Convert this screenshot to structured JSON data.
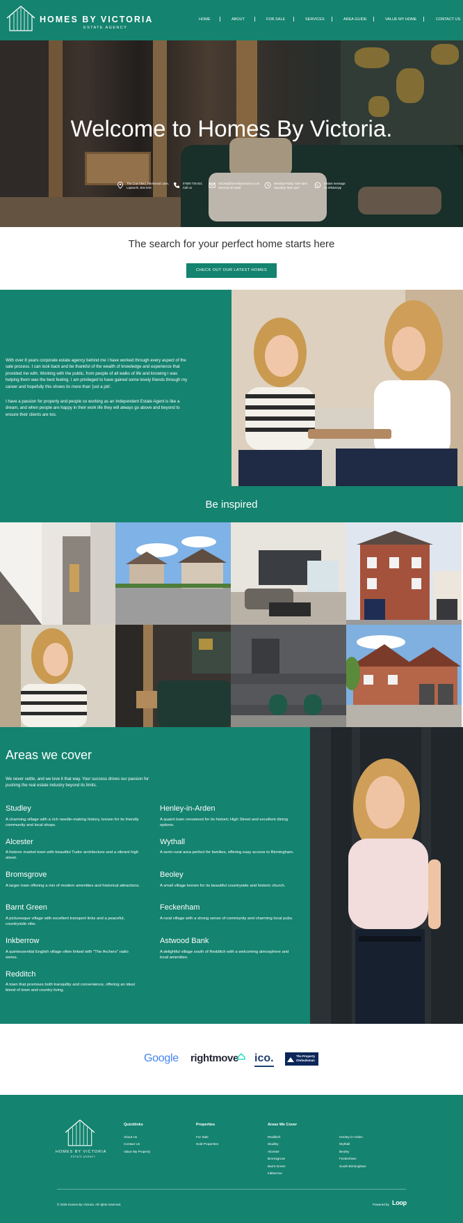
{
  "header": {
    "logo_title": "HOMES BY VICTORIA",
    "logo_subtitle": "ESTATE AGENCY",
    "nav": [
      "HOME",
      "ABOUT",
      "FOR SALE",
      "SERVICES",
      "AREA GUIDE",
      "VALUE MY HOME",
      "CONTACT US"
    ]
  },
  "hero": {
    "title": "Welcome to Homes By Victoria.",
    "info": [
      {
        "icon": "location-pin-icon",
        "line1": "The Cow Shed, Peckwood Lane,",
        "line2": "Lapworth, B94 6AE"
      },
      {
        "icon": "phone-icon",
        "line1": "07500 726 021",
        "line2": "Call us"
      },
      {
        "icon": "mail-icon",
        "line1": "victoria@homesbyvictoria.co.uk",
        "line2": "Send us an email"
      },
      {
        "icon": "clock-icon",
        "line1": "Monday-Friday: 9am-5pm",
        "line2": "Saturday: 9am-1pm"
      },
      {
        "icon": "whatsapp-icon",
        "line1": "Instant message",
        "line2": "on WhatsApp"
      }
    ]
  },
  "search": {
    "heading": "The search for your perfect home starts here",
    "cta": "CHECK OUT OUR LATEST HOMES"
  },
  "about": {
    "p1": "With over 8 years corporate estate agency behind me I have worked through every aspect of the sale process. I can look back and be thankful of the wealth of knowledge and experience that provided me with. Working with the public, from people of all walks of life and knowing I was helping them was the best feeling. I am privileged to have gained some lovely friends through my career and hopefully this shows its more than 'just a job'.",
    "p2": "I have a passion for property and people so working as an Independent Estate Agent is like a dream, and when people are happy in their work life they will always go above and beyond to ensure their clients are too."
  },
  "inspired": {
    "title": "Be inspired"
  },
  "areas": {
    "title": "Areas we cover",
    "intro": "We never settle, and we love it that way. Your success drives our passion for pushing the real estate industry beyond its limits.",
    "left": [
      {
        "name": "Studley",
        "desc": "A charming village with a rich needle-making history, known for its friendly community and local shops."
      },
      {
        "name": "Alcester",
        "desc": "A historic market town with beautiful Tudor architecture and a vibrant high street."
      },
      {
        "name": "Bromsgrove",
        "desc": "A larger town offering a mix of modern amenities and historical attractions."
      },
      {
        "name": "Barnt Green",
        "desc": "A picturesque village with excellent transport links and a peaceful, countryside vibe."
      },
      {
        "name": "Inkberrow",
        "desc": "A quintessential English village often linked with \"The Archers\" radio series."
      },
      {
        "name": "Redditch",
        "desc": "A town that promises both tranquility and convenience, offering an ideal blend of town and country living."
      }
    ],
    "right": [
      {
        "name": "Henley-in-Arden",
        "desc": "A quaint town renowned for its historic High Street and excellent dining options."
      },
      {
        "name": "Wythall",
        "desc": "A semi-rural area perfect for families, offering easy access to Birmingham."
      },
      {
        "name": "Beoley",
        "desc": "A small village known for its beautiful countryside and historic church."
      },
      {
        "name": "Feckenham",
        "desc": "A rural village with a strong sense of community and charming local pubs."
      },
      {
        "name": "Astwood Bank",
        "desc": "A delightful village south of Redditch with a welcoming atmosphere and local amenities."
      }
    ]
  },
  "partners": {
    "google": "Google",
    "rightmove": "rightmove",
    "ico": "ico.",
    "tpo_line1": "The Property",
    "tpo_line2": "Ombudsman"
  },
  "footer": {
    "logo_title": "HOMES BY VICTORIA",
    "logo_subtitle": "ESTATE AGENCY",
    "quicklinks_title": "Quicklinks",
    "quicklinks": [
      "About Us",
      "Contact Us",
      "Value My Property"
    ],
    "properties_title": "Properties",
    "properties": [
      "For Sale",
      "Sold Properties"
    ],
    "areas_title": "Areas We Cover",
    "areas_col1": [
      "Redditch",
      "Studley",
      "Alcester",
      "Bromsgrove",
      "Barnt Green",
      "Inkberrow"
    ],
    "areas_col2": [
      "Henley-in-Arden",
      "Wythall",
      "Beoley",
      "Feckenham",
      "South Birmingham"
    ],
    "copyright": "© 2025 Homes By Victoria. All rights reserved.",
    "powered_by": "Powered by",
    "powered_brand": "Loop"
  },
  "colors": {
    "brand_teal": "#14836f",
    "white": "#ffffff",
    "heading_text": "#333333"
  }
}
